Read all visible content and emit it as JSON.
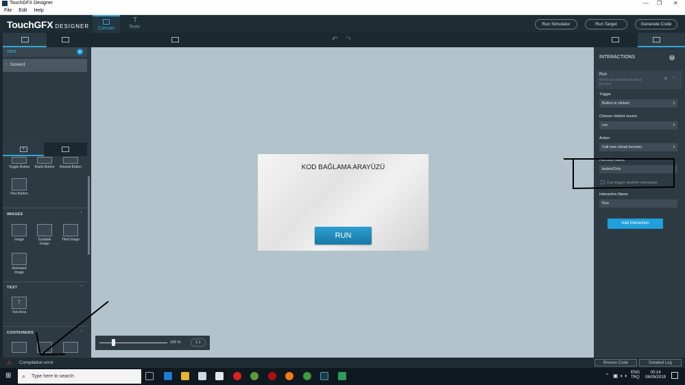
{
  "window": {
    "title": "TouchGFX Designer"
  },
  "menu": {
    "file": "File",
    "edit": "Edit",
    "help": "Help"
  },
  "header": {
    "logo": "TouchGFX",
    "logo_sub": "DESIGNER",
    "tabs": [
      {
        "label": "Canvas",
        "icon": "canvas-icon"
      },
      {
        "label": "Texts",
        "icon": "texts-icon"
      }
    ],
    "run_simulator": "Run Simulator",
    "run_target": "Run Target",
    "generate_code": "Generate Code"
  },
  "left": {
    "screens_title": "TEST",
    "screens": [
      "Screen1"
    ],
    "widgets_row1": [
      "Toggle Button",
      "Radio Button",
      "Repeat Button"
    ],
    "flex_button": "Flex Button",
    "images_title": "IMAGES",
    "images": [
      "Image",
      "Scalable Image",
      "Tiled Image",
      "Animated Image"
    ],
    "text_title": "TEXT",
    "text_area": "Text Area",
    "containers_title": "CONTAINERS"
  },
  "canvas": {
    "screen_title": "KOD BAĞLAMA ARAYÜZÜ",
    "button_label": "RUN",
    "zoom": "100 %",
    "zoom_ratio": "1:1",
    "zoom_level": 0.2
  },
  "interactions": {
    "title": "INTERACTIONS",
    "help": "?",
    "name": "Run",
    "desc": "When run clicked call virtual function",
    "trigger_label": "Trigger",
    "trigger_value": "Button is clicked",
    "source_label": "Choose clicked source",
    "source_value": "run",
    "action_label": "Action",
    "action_value": "Call new virtual function",
    "function_label": "Function Name",
    "function_value": "buttonClick",
    "can_trigger": "Can trigger another interaction",
    "interaction_name_label": "Interaction Name",
    "interaction_name_value": "Run",
    "add_button": "Add Interaction"
  },
  "status": {
    "message": "Compilation error",
    "browse_code": "Browse Code",
    "detailed_log": "Detailed Log"
  },
  "taskbar": {
    "search_placeholder": "Type here to search",
    "lang": "ENG",
    "region": "TRQ",
    "time": "00:14",
    "date": "08/09/2019"
  },
  "colors": {
    "accent": "#2fa8d8",
    "header_bg": "#1e2c34",
    "panel_bg": "#2e3a42",
    "canvas_bg": "#b3c3cb",
    "error": "#e04040"
  }
}
